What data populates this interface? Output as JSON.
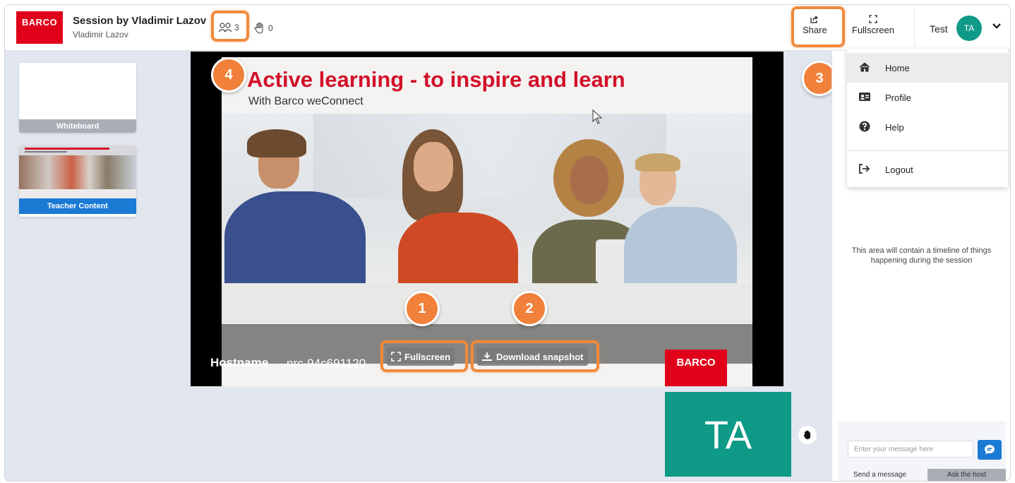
{
  "header": {
    "logo_text": "BARCO",
    "session_title": "Session by Vladimir Lazov",
    "session_host": "Vladimir Lazov",
    "participants_count": "3",
    "hands_count": "0",
    "share_label": "Share",
    "fullscreen_label": "Fullscreen",
    "user_name": "Test",
    "user_initials": "TA"
  },
  "sidebar": {
    "items": [
      {
        "label": "Whiteboard"
      },
      {
        "label": "Teacher Content"
      }
    ]
  },
  "slide": {
    "title": "Active learning - to inspire and learn",
    "subtitle": "With Barco weConnect",
    "hostname_label": "Hostname",
    "hostname_value": "nrc-94c691120",
    "fullscreen_button": "Fullscreen",
    "download_button": "Download snapshot",
    "logo_text": "BARCO"
  },
  "video_tile": {
    "initials": "TA"
  },
  "callouts": [
    "1",
    "2",
    "3",
    "4"
  ],
  "dropdown": {
    "items": [
      {
        "label": "Home",
        "icon": "home-icon"
      },
      {
        "label": "Profile",
        "icon": "id-card-icon"
      },
      {
        "label": "Help",
        "icon": "question-icon"
      },
      {
        "label": "Logout",
        "icon": "logout-icon"
      }
    ]
  },
  "timeline": {
    "placeholder": "This area will contain a timeline of things happening during the session"
  },
  "chat": {
    "input_placeholder": "Enter your message here",
    "tab_send": "Send a message",
    "tab_ask": "Ask the host"
  },
  "colors": {
    "accent_orange": "#f08a3c",
    "brand_red": "#e0001a",
    "teal": "#0e9a87",
    "blue": "#1a7ad4"
  }
}
